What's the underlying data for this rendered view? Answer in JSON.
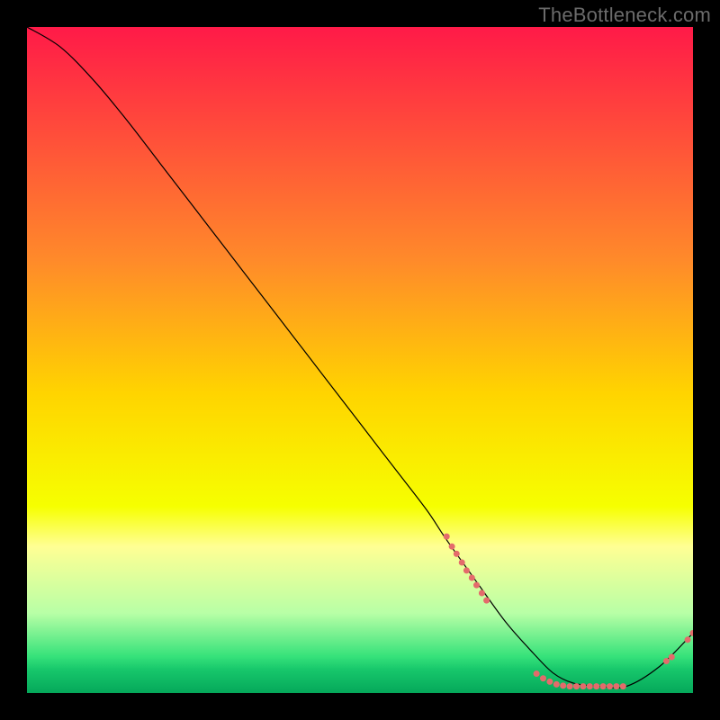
{
  "watermark": "TheBottleneck.com",
  "chart_data": {
    "type": "line",
    "title": "",
    "xlabel": "",
    "ylabel": "",
    "xlim": [
      0,
      100
    ],
    "ylim": [
      0,
      100
    ],
    "grid": false,
    "legend": false,
    "gradient_stops": [
      {
        "offset": 0.0,
        "color": "#ff1a48"
      },
      {
        "offset": 0.35,
        "color": "#ff8a2a"
      },
      {
        "offset": 0.55,
        "color": "#ffd400"
      },
      {
        "offset": 0.72,
        "color": "#f6ff00"
      },
      {
        "offset": 0.78,
        "color": "#ffff94"
      },
      {
        "offset": 0.88,
        "color": "#b8ffa6"
      },
      {
        "offset": 0.945,
        "color": "#36e27a"
      },
      {
        "offset": 0.965,
        "color": "#17c76b"
      },
      {
        "offset": 1.0,
        "color": "#05a85a"
      }
    ],
    "series": [
      {
        "name": "bottleneck-curve",
        "x": [
          0,
          5,
          10,
          15,
          20,
          25,
          30,
          35,
          40,
          45,
          50,
          55,
          60,
          63,
          68,
          72,
          76,
          79,
          82,
          86,
          90,
          95,
          100
        ],
        "y": [
          100,
          97,
          92,
          86,
          79.5,
          73,
          66.5,
          60,
          53.5,
          47,
          40.5,
          34,
          27.5,
          23,
          16,
          10.5,
          6,
          3,
          1.5,
          1,
          1,
          4,
          9
        ],
        "color": "#000000",
        "linewidth": 1.2
      }
    ],
    "scatter": [
      {
        "name": "highlight-dots",
        "color": "#e46b6b",
        "size": 7,
        "points": [
          [
            63,
            23.5
          ],
          [
            63.8,
            22
          ],
          [
            64.5,
            20.9
          ],
          [
            65.3,
            19.6
          ],
          [
            66,
            18.4
          ],
          [
            66.8,
            17.3
          ],
          [
            67.5,
            16.2
          ],
          [
            68.3,
            15
          ],
          [
            69,
            13.9
          ],
          [
            76.5,
            2.9
          ],
          [
            77.5,
            2.2
          ],
          [
            78.5,
            1.7
          ],
          [
            79.5,
            1.3
          ],
          [
            80.5,
            1.1
          ],
          [
            81.5,
            1.0
          ],
          [
            82.5,
            1.0
          ],
          [
            83.5,
            1.0
          ],
          [
            84.5,
            1.0
          ],
          [
            85.5,
            1.0
          ],
          [
            86.5,
            1.0
          ],
          [
            87.5,
            1.0
          ],
          [
            88.5,
            1.0
          ],
          [
            89.5,
            1.0
          ],
          [
            96,
            4.8
          ],
          [
            96.8,
            5.4
          ],
          [
            99.2,
            8.0
          ],
          [
            100,
            9.0
          ]
        ]
      }
    ]
  }
}
